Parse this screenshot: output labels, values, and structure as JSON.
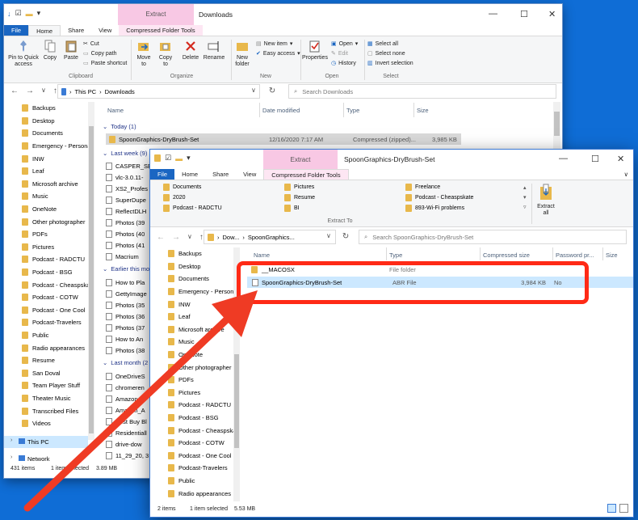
{
  "bg_window": {
    "quick_access_toolbar": [
      "↓",
      "☑",
      "▬",
      "▾"
    ],
    "context_tab": "Extract",
    "title": "Downloads",
    "tabs": {
      "file": "File",
      "home": "Home",
      "share": "Share",
      "view": "View",
      "compressed": "Compressed Folder Tools"
    },
    "ribbon": {
      "pin": "Pin to Quick access",
      "copy": "Copy",
      "paste": "Paste",
      "cut": "Cut",
      "copy_path": "Copy path",
      "paste_shortcut": "Paste shortcut",
      "clipboard": "Clipboard",
      "move_to": "Move to",
      "copy_to": "Copy to",
      "delete": "Delete",
      "rename": "Rename",
      "organize": "Organize",
      "new_folder": "New folder",
      "new_item": "New item",
      "easy_access": "Easy access",
      "new": "New",
      "properties": "Properties",
      "open": "Open",
      "edit": "Edit",
      "history": "History",
      "open_group": "Open",
      "select_all": "Select all",
      "select_none": "Select none",
      "invert_selection": "Invert selection",
      "select": "Select"
    },
    "address": {
      "root": "This PC",
      "folder": "Downloads"
    },
    "search_placeholder": "Search Downloads",
    "columns": {
      "name": "Name",
      "date": "Date modified",
      "type": "Type",
      "size": "Size"
    },
    "groups": {
      "today": "Today (1)",
      "last_week": "Last week (9)",
      "earlier": "Earlier this mo",
      "last_month": "Last month (2"
    },
    "today_file": {
      "name": "SpoonGraphics-DryBrush-Set",
      "date": "12/16/2020 7:17 AM",
      "type": "Compressed (zipped)...",
      "size": "3,985 KB"
    },
    "last_week_files": [
      "CASPER_SE",
      "vlc-3.0.11-",
      "XS2_Profes",
      "SuperDupe",
      "ReflectDLH",
      "Photos (39",
      "Photos (40",
      "Photos (41",
      "Macrium"
    ],
    "earlier_files": [
      "How to Pla",
      "GettyImage",
      "Photos (35",
      "Photos (36",
      "Photos (37",
      "How to An",
      "Photos (38"
    ],
    "last_month_files": [
      "OneDriveS",
      "chromeren",
      "Amazon_A",
      "Amazon_A",
      "Best Buy Bl",
      "Residentiall",
      "drive-dow",
      "11_29_20, 3"
    ],
    "nav": [
      "Backups",
      "Desktop",
      "Documents",
      "Emergency - Persona",
      "INW",
      "Leaf",
      "Microsoft archive",
      "Music",
      "OneNote",
      "Other photographer",
      "PDFs",
      "Pictures",
      "Podcast - RADCTU",
      "Podcast - BSG",
      "Podcast - Cheaspska",
      "Podcast - COTW",
      "Podcast - One Cool",
      "Podcast-Travelers",
      "Public",
      "Radio appearances",
      "Resume",
      "San Doval",
      "Team Player Stuff",
      "Theater Music",
      "Transcribed Files",
      "Videos"
    ],
    "this_pc": "This PC",
    "network": "Network",
    "status": {
      "count": "431 items",
      "selected": "1 item selected",
      "size": "3.89 MB"
    }
  },
  "fg_window": {
    "context_tab": "Extract",
    "title": "SpoonGraphics-DryBrush-Set",
    "tabs": {
      "file": "File",
      "home": "Home",
      "share": "Share",
      "view": "View",
      "compressed": "Compressed Folder Tools"
    },
    "extract_to": [
      "Documents",
      "2020",
      "Podcast - RADCTU",
      "Pictures",
      "Resume",
      "BI",
      "Freelance",
      "Podcast - Cheaspskate",
      "893-Wi-Fi problems"
    ],
    "extract_all": "Extract all",
    "extract_to_label": "Extract To",
    "address": {
      "root": "Dow...",
      "folder": "SpoonGraphics..."
    },
    "search_placeholder": "Search SpoonGraphics-DryBrush-Set",
    "columns": {
      "name": "Name",
      "type": "Type",
      "compressed": "Compressed size",
      "password": "Password pr...",
      "size": "Size"
    },
    "rows": [
      {
        "name": "__MACOSX",
        "type": "File folder",
        "compressed": "",
        "password": ""
      },
      {
        "name": "SpoonGraphics-DryBrush-Set",
        "type": "ABR File",
        "compressed": "3,984 KB",
        "password": "No"
      }
    ],
    "nav": [
      "Backups",
      "Desktop",
      "Documents",
      "Emergency - Persona",
      "INW",
      "Leaf",
      "Microsoft archive",
      "Music",
      "OneNote",
      "Other photographer",
      "PDFs",
      "Pictures",
      "Podcast - RADCTU",
      "Podcast - BSG",
      "Podcast - Cheaspska",
      "Podcast - COTW",
      "Podcast - One Cool",
      "Podcast-Travelers",
      "Public",
      "Radio appearances"
    ],
    "status": {
      "count": "2 items",
      "selected": "1 item selected",
      "size": "5.53 MB"
    }
  },
  "colors": {
    "desktop": "#0f6dd6",
    "accent": "#1a66c2",
    "context_tab": "#f8c8e4",
    "highlight": "#ff2a16",
    "selection": "#cce8ff"
  }
}
